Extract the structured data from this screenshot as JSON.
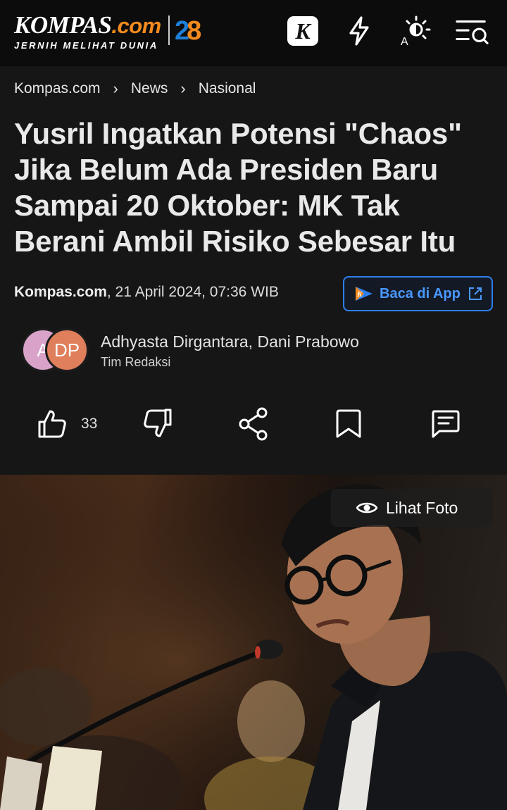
{
  "header": {
    "logo_main": "KOMPAS",
    "logo_dotcom": ".com",
    "logo_tagline": "JERNIH MELIHAT DUNIA",
    "anniversary_digit1": "2",
    "anniversary_digit2": "8",
    "k_badge": "K",
    "icons": [
      "kompas-k-icon",
      "flash-icon",
      "brightness-icon",
      "menu-search-icon"
    ]
  },
  "breadcrumb": {
    "items": [
      "Kompas.com",
      "News",
      "Nasional"
    ],
    "separator": "›"
  },
  "article": {
    "title": "Yusril Ingatkan Potensi \"Chaos\" Jika Belum Ada Presiden Baru Sampai 20 Oktober: MK Tak Berani Ambil Risiko Sebesar Itu",
    "source": "Kompas.com",
    "date": ", 21 April 2024, 07:36 WIB",
    "app_button_label": "Baca di App",
    "authors": "Adhyasta Dirgantara, Dani Prabowo",
    "team": "Tim Redaksi",
    "avatar_initials": [
      "A",
      "DP"
    ],
    "like_count": "33"
  },
  "photo": {
    "view_photo_label": "Lihat Foto"
  },
  "colors": {
    "background": "#161616",
    "header": "#0c0c0c",
    "accent_blue": "#2f80ed",
    "brand_orange": "#f28a1e"
  }
}
